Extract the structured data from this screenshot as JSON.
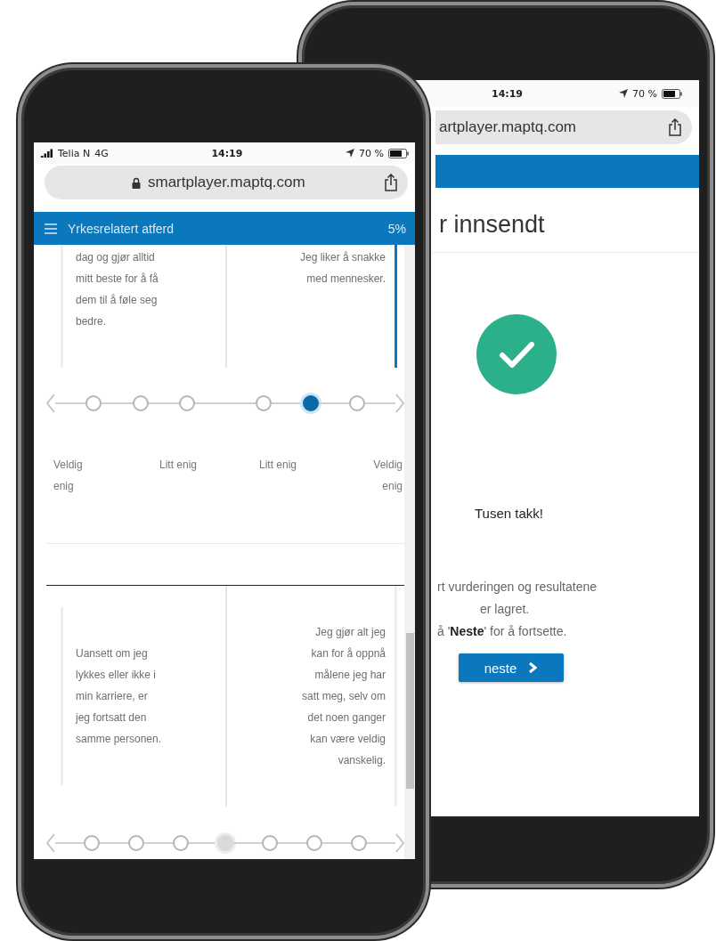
{
  "back_phone": {
    "status_bar": {
      "time": "14:19",
      "battery": "70 %"
    },
    "url": "artplayer.maptq.com",
    "page_title": "r innsendt",
    "thanks": "Tusen takk!",
    "message_lines": [
      "rt vurderingen og resultatene",
      "er lagret.",
      "å '**Neste**' for å fortsette."
    ],
    "next_button": "neste"
  },
  "front_phone": {
    "status_bar": {
      "carrier": "Telia N",
      "network": "4G",
      "time": "14:19",
      "battery": "70 %"
    },
    "url": "smartplayer.maptq.com",
    "header": {
      "title": "Yrkesrelatert atferd",
      "progress": "5%"
    },
    "questions": [
      {
        "statements": [
          {
            "text": "dag og gjør alltid mitt beste for å få dem til å føle seg bedre.",
            "selected": false
          },
          {
            "text": "Jeg liker å snakke med mennesker.",
            "selected": true
          }
        ],
        "scale": [
          {
            "kind": "circle",
            "selected": false
          },
          {
            "kind": "circle",
            "selected": false
          },
          {
            "kind": "circle",
            "selected": false
          },
          {
            "kind": "blank",
            "selected": false
          },
          {
            "kind": "circle",
            "selected": false
          },
          {
            "kind": "circle",
            "selected": true
          },
          {
            "kind": "circle",
            "selected": false
          }
        ],
        "scale_labels": [
          "Veldig enig",
          "Litt enig",
          "Litt enig",
          "Veldig enig"
        ]
      },
      {
        "statements": [
          {
            "text": "Uansett om jeg lykkes eller ikke i min karriere, er jeg fortsatt den samme personen.",
            "selected": false
          },
          {
            "text": "Jeg gjør alt jeg kan for å oppnå målene jeg har satt meg, selv om det noen ganger kan være veldig vanskelig.",
            "selected": false
          }
        ],
        "scale": [
          {
            "kind": "circle",
            "selected": false
          },
          {
            "kind": "circle",
            "selected": false
          },
          {
            "kind": "circle",
            "selected": false
          },
          {
            "kind": "midpoint",
            "selected": false
          },
          {
            "kind": "circle",
            "selected": false
          },
          {
            "kind": "circle",
            "selected": false
          },
          {
            "kind": "circle",
            "selected": false
          }
        ]
      }
    ]
  }
}
